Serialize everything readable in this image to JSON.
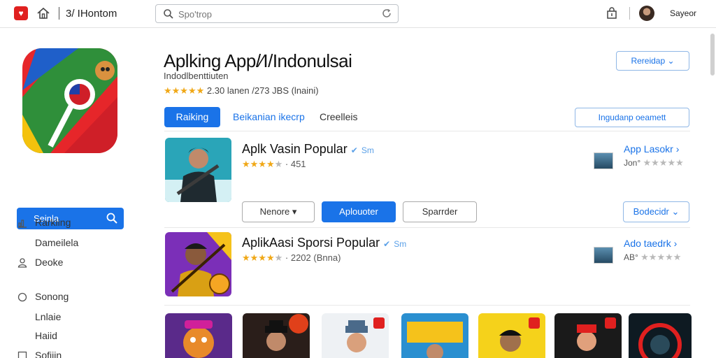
{
  "topbar": {
    "logo_glyph": "♥",
    "title": "3/ IHontom",
    "search_placeholder": "Spo'trop",
    "user_name": "Sayeor"
  },
  "sidebar": {
    "button_label": "Seinla",
    "items": [
      {
        "label": "Rarkiing",
        "icon": "chart-icon"
      },
      {
        "label": "Dameilela",
        "icon": ""
      },
      {
        "label": "Deoke",
        "icon": "user-icon"
      },
      {
        "label": "Sonong",
        "icon": "circle-icon"
      },
      {
        "label": "Lnlaie",
        "icon": ""
      },
      {
        "label": "Haiid",
        "icon": ""
      },
      {
        "label": "Sofiiin",
        "icon": "square-icon"
      }
    ]
  },
  "header": {
    "title": "Aplking App/⁄I/Indonulsai",
    "subtitle": "Indodlbenttiuten",
    "rating_text": "2.30 lanen /273 JBS (lnaini)",
    "stars": 5,
    "dropdown_label": "Rereidap"
  },
  "tabs": [
    {
      "label": "Raiking",
      "active": true
    },
    {
      "label": "Beikanian ikecrp",
      "active": false
    },
    {
      "label": "Creelleis",
      "active": false
    }
  ],
  "right_button_label": "Ingudanp oeamett",
  "cards": [
    {
      "title": "Aplk Vasin Popular",
      "badge": "Sm",
      "stars": 4,
      "meta": "· 451",
      "link": "App Lasokr",
      "rating_stars_gray": 4,
      "mini_meta": "Jon°"
    },
    {
      "title": "AplikAasi Sporsi Popular",
      "badge": "Sm",
      "stars": 4,
      "meta": "· 2202 (Bnna)",
      "link": "Ado taedrk",
      "rating_stars_gray": 4,
      "mini_meta": "AB°"
    }
  ],
  "card_actions": {
    "more_label": "Nenore",
    "primary_label": "Aplouoter",
    "secondary_label": "Sparrder",
    "dropdown_label": "Bodecidr"
  },
  "colors": {
    "accent": "#1a73e8",
    "star": "#f0a817",
    "brand_red": "#e0201f"
  }
}
